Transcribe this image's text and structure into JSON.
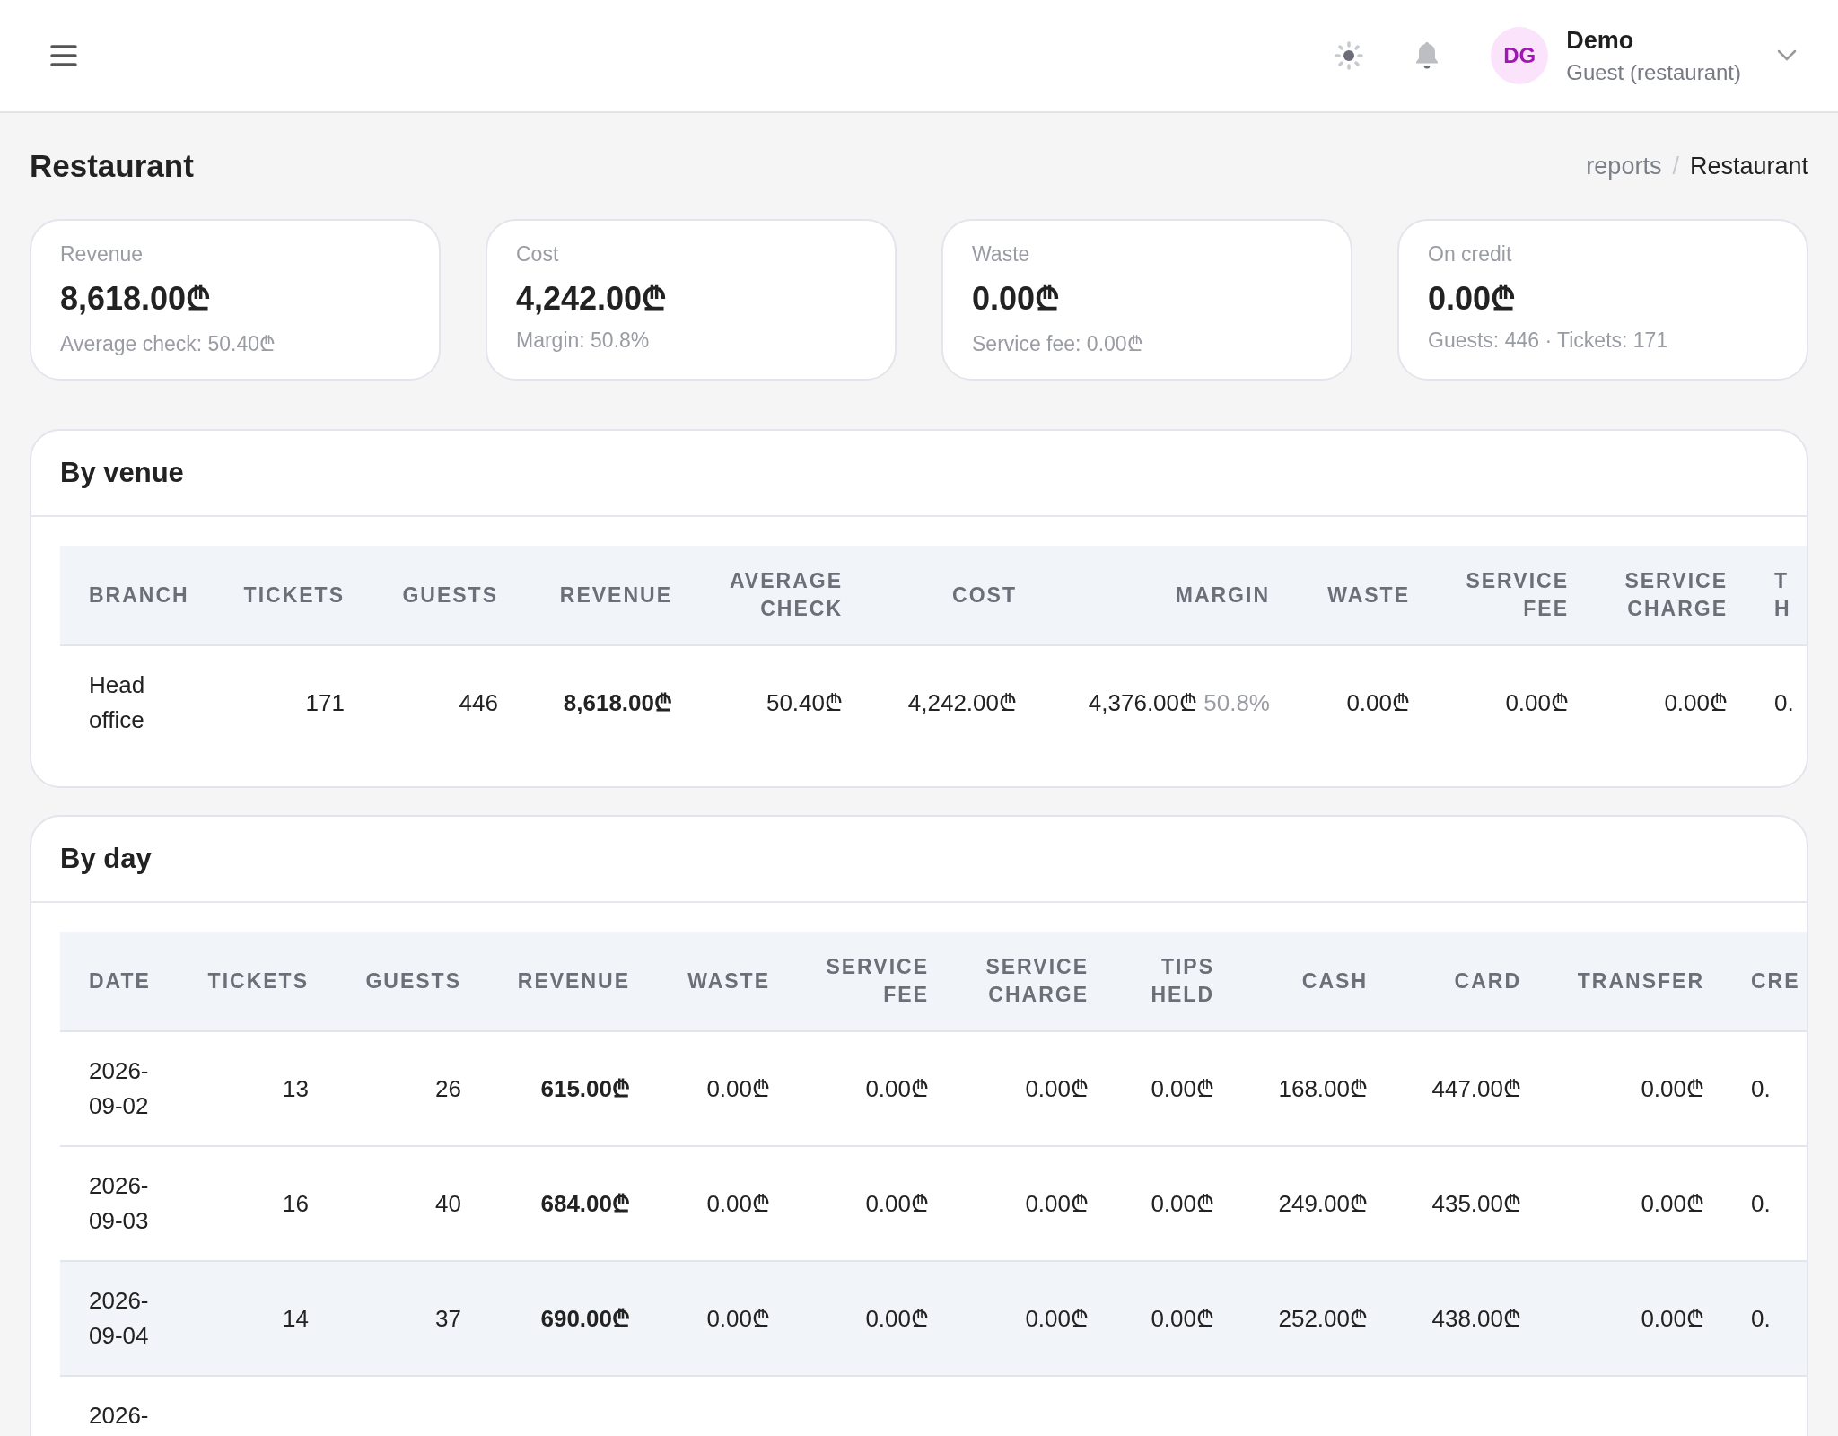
{
  "topbar": {
    "user": {
      "initials": "DG",
      "name": "Demo",
      "role": "Guest (restaurant)"
    }
  },
  "page": {
    "title": "Restaurant",
    "breadcrumb_separator": "/",
    "breadcrumb": [
      {
        "label": "reports",
        "current": false
      },
      {
        "label": "Restaurant",
        "current": true
      }
    ]
  },
  "stats": [
    {
      "label": "Revenue",
      "value": "8,618.00₾",
      "detail": "Average check: 50.40₾"
    },
    {
      "label": "Cost",
      "value": "4,242.00₾",
      "detail": "Margin: 50.8%"
    },
    {
      "label": "Waste",
      "value": "0.00₾",
      "detail": "Service fee: 0.00₾"
    },
    {
      "label": "On credit",
      "value": "0.00₾",
      "detail": "Guests: 446 · Tickets: 171"
    }
  ],
  "by_venue": {
    "title": "By venue",
    "columns": [
      {
        "label": "BRANCH",
        "kind": "text"
      },
      {
        "label": "TICKETS",
        "kind": "number"
      },
      {
        "label": "GUESTS",
        "kind": "number"
      },
      {
        "label": "REVENUE",
        "kind": "total"
      },
      {
        "label": "AVERAGE CHECK",
        "kind": "number"
      },
      {
        "label": "COST",
        "kind": "number"
      },
      {
        "label": "MARGIN",
        "kind": "number"
      },
      {
        "label": "WASTE",
        "kind": "number"
      },
      {
        "label": "SERVICE FEE",
        "kind": "number"
      },
      {
        "label": "SERVICE CHARGE",
        "kind": "number"
      },
      {
        "label": "T H",
        "kind": "number"
      }
    ],
    "rows": [
      {
        "highlighted": false,
        "cells": [
          {
            "text": "Head office"
          },
          {
            "text": "171"
          },
          {
            "text": "446"
          },
          {
            "text": "8,618.00₾"
          },
          {
            "text": "50.40₾"
          },
          {
            "text": "4,242.00₾"
          },
          {
            "text": "4,376.00₾",
            "note": "50.8%"
          },
          {
            "text": "0.00₾"
          },
          {
            "text": "0.00₾"
          },
          {
            "text": "0.00₾"
          },
          {
            "text": "0."
          }
        ]
      }
    ]
  },
  "by_day": {
    "title": "By day",
    "columns": [
      {
        "label": "DATE",
        "kind": "text"
      },
      {
        "label": "TICKETS",
        "kind": "number"
      },
      {
        "label": "GUESTS",
        "kind": "number"
      },
      {
        "label": "REVENUE",
        "kind": "total"
      },
      {
        "label": "WASTE",
        "kind": "number"
      },
      {
        "label": "SERVICE FEE",
        "kind": "number"
      },
      {
        "label": "SERVICE CHARGE",
        "kind": "number"
      },
      {
        "label": "TIPS HELD",
        "kind": "number"
      },
      {
        "label": "CASH",
        "kind": "number"
      },
      {
        "label": "CARD",
        "kind": "number"
      },
      {
        "label": "TRANSFER",
        "kind": "number"
      },
      {
        "label": "CRE",
        "kind": "number"
      }
    ],
    "rows": [
      {
        "highlighted": false,
        "cells": [
          {
            "text": "2026-09-02"
          },
          {
            "text": "13"
          },
          {
            "text": "26"
          },
          {
            "text": "615.00₾"
          },
          {
            "text": "0.00₾"
          },
          {
            "text": "0.00₾"
          },
          {
            "text": "0.00₾"
          },
          {
            "text": "0.00₾"
          },
          {
            "text": "168.00₾"
          },
          {
            "text": "447.00₾"
          },
          {
            "text": "0.00₾"
          },
          {
            "text": "0."
          }
        ]
      },
      {
        "highlighted": false,
        "cells": [
          {
            "text": "2026-09-03"
          },
          {
            "text": "16"
          },
          {
            "text": "40"
          },
          {
            "text": "684.00₾"
          },
          {
            "text": "0.00₾"
          },
          {
            "text": "0.00₾"
          },
          {
            "text": "0.00₾"
          },
          {
            "text": "0.00₾"
          },
          {
            "text": "249.00₾"
          },
          {
            "text": "435.00₾"
          },
          {
            "text": "0.00₾"
          },
          {
            "text": "0."
          }
        ]
      },
      {
        "highlighted": true,
        "cells": [
          {
            "text": "2026-09-04"
          },
          {
            "text": "14"
          },
          {
            "text": "37"
          },
          {
            "text": "690.00₾"
          },
          {
            "text": "0.00₾"
          },
          {
            "text": "0.00₾"
          },
          {
            "text": "0.00₾"
          },
          {
            "text": "0.00₾"
          },
          {
            "text": "252.00₾"
          },
          {
            "text": "438.00₾"
          },
          {
            "text": "0.00₾"
          },
          {
            "text": "0."
          }
        ]
      },
      {
        "highlighted": false,
        "cells": [
          {
            "text": "2026-"
          }
        ]
      }
    ]
  }
}
